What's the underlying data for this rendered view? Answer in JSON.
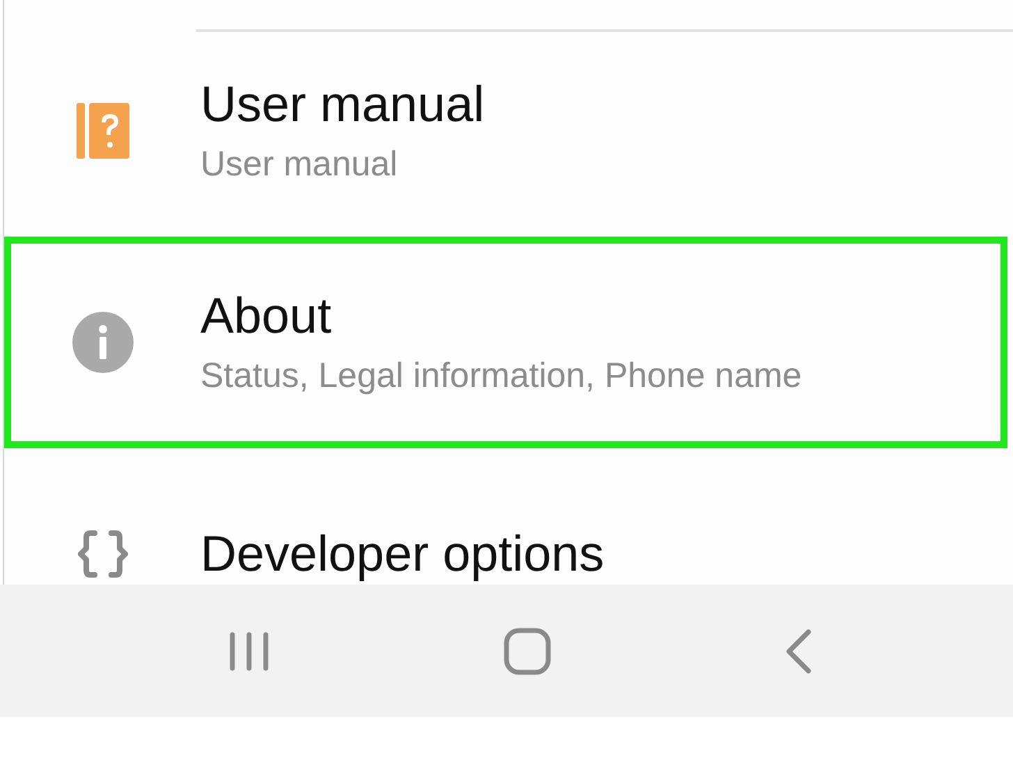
{
  "settings": [
    {
      "kind": "manual",
      "title": "User manual",
      "subtitle": "User manual",
      "highlighted": false
    },
    {
      "kind": "info",
      "title": "About",
      "subtitle": "Status, Legal information, Phone name",
      "highlighted": true
    },
    {
      "kind": "developer",
      "title": "Developer options",
      "highlighted": false
    }
  ],
  "nav_bar": [
    {
      "kind": "recents"
    },
    {
      "kind": "home"
    },
    {
      "kind": "back"
    }
  ]
}
